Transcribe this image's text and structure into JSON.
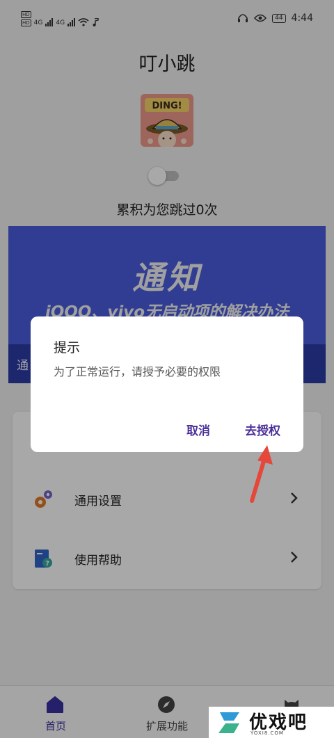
{
  "status_bar": {
    "network_left": "4G",
    "network_right": "4G",
    "battery": "44",
    "time": "4:44"
  },
  "app": {
    "title": "叮小跳",
    "avatar_text": "DING!",
    "service_enabled": false,
    "counter_text": "累积为您跳过0次"
  },
  "banner": {
    "title": "通知",
    "subtitle": "iQOO、vivo无启动项的解决办法",
    "strip_text": "通"
  },
  "menu": {
    "items": [
      {
        "label": "通用设置",
        "icon": "gear-icon"
      },
      {
        "label": "使用帮助",
        "icon": "help-book-icon"
      }
    ]
  },
  "bottom_nav": {
    "items": [
      {
        "label": "首页",
        "icon": "home-icon",
        "active": true
      },
      {
        "label": "扩展功能",
        "icon": "compass-icon",
        "active": false
      }
    ]
  },
  "dialog": {
    "title": "提示",
    "message": "为了正常运行，请授予必要的权限",
    "cancel_label": "取消",
    "grant_label": "去授权"
  },
  "watermark": {
    "text": "优戏吧",
    "url": "YOXI8.COM"
  },
  "colors": {
    "accent": "#3b2fa0",
    "banner_blue": "#4a5dde",
    "annotation_arrow": "#e5473a"
  }
}
